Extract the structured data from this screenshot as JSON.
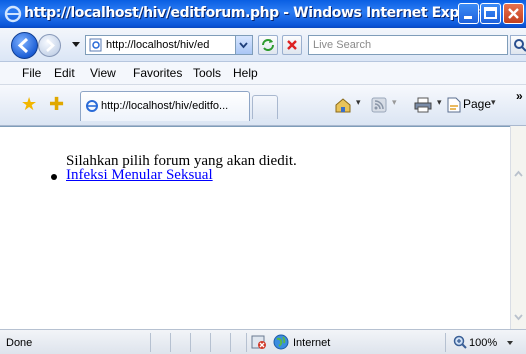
{
  "window": {
    "title": "http://localhost/hiv/editforum.php - Windows Internet Explorer"
  },
  "nav": {
    "address": "http://localhost/hiv/ed",
    "search_placeholder": "Live Search"
  },
  "menu": {
    "items": [
      "File",
      "Edit",
      "View",
      "Favorites",
      "Tools",
      "Help"
    ]
  },
  "tab": {
    "label": "http://localhost/hiv/editfo..."
  },
  "commandbar": {
    "page_label": "Page",
    "overflow": "»"
  },
  "page": {
    "message": "Silahkan pilih forum yang akan diedit.",
    "forums": [
      "Infeksi Menular Seksual"
    ]
  },
  "status": {
    "text": "Done",
    "zone": "Internet",
    "zoom": "100%"
  },
  "colors": {
    "titlebar": "#0a5fe3",
    "link": "#0000ff",
    "close_button": "#c2401f"
  }
}
